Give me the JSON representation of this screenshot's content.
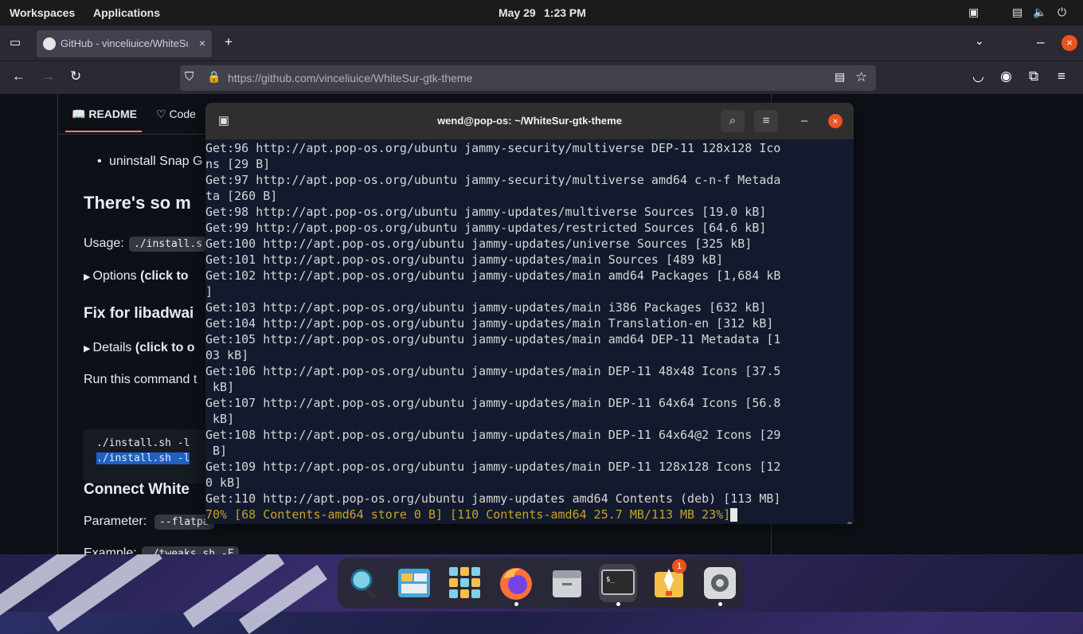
{
  "top_bar": {
    "workspaces": "Workspaces",
    "applications": "Applications",
    "date": "May 29",
    "time": "1:23 PM"
  },
  "browser": {
    "tab_title": "GitHub - vinceliuice/WhiteSur-gtk-theme",
    "tab_close": "×",
    "new_tab": "+",
    "url_prefix": "https://github.com/",
    "url_path": "vinceliuice/WhiteSur-gtk-theme"
  },
  "readme": {
    "tab_readme": "README",
    "tab_code": "Code",
    "bullet_text": "uninstall Snap G",
    "heading_more": "There's so m",
    "usage_label": "Usage:",
    "usage_code": "./install.s",
    "options_label": "Options",
    "options_bold": "(click to",
    "heading_libadwaita": "Fix for libadwai",
    "details_label": "Details",
    "details_bold": "(click to o",
    "run_command": "Run this command t",
    "code_line1": "./install.sh -l",
    "code_line2": "./install.sh -l",
    "heading_connect": "Connect White",
    "parameter_label": "Parameter:",
    "parameter_code": "--flatpa",
    "example_label": "Example:",
    "example_code": "./tweaks.sh -F"
  },
  "terminal": {
    "title": "wend@pop-os: ~/WhiteSur-gtk-theme",
    "lines": [
      "Get:96 http://apt.pop-os.org/ubuntu jammy-security/multiverse DEP-11 128x128 Ico",
      "ns [29 B]",
      "Get:97 http://apt.pop-os.org/ubuntu jammy-security/multiverse amd64 c-n-f Metada",
      "ta [260 B]",
      "Get:98 http://apt.pop-os.org/ubuntu jammy-updates/multiverse Sources [19.0 kB]",
      "Get:99 http://apt.pop-os.org/ubuntu jammy-updates/restricted Sources [64.6 kB]",
      "Get:100 http://apt.pop-os.org/ubuntu jammy-updates/universe Sources [325 kB]",
      "Get:101 http://apt.pop-os.org/ubuntu jammy-updates/main Sources [489 kB]",
      "Get:102 http://apt.pop-os.org/ubuntu jammy-updates/main amd64 Packages [1,684 kB",
      "]",
      "Get:103 http://apt.pop-os.org/ubuntu jammy-updates/main i386 Packages [632 kB]",
      "Get:104 http://apt.pop-os.org/ubuntu jammy-updates/main Translation-en [312 kB]",
      "Get:105 http://apt.pop-os.org/ubuntu jammy-updates/main amd64 DEP-11 Metadata [1",
      "03 kB]",
      "Get:106 http://apt.pop-os.org/ubuntu jammy-updates/main DEP-11 48x48 Icons [37.5",
      " kB]",
      "Get:107 http://apt.pop-os.org/ubuntu jammy-updates/main DEP-11 64x64 Icons [56.8",
      " kB]",
      "Get:108 http://apt.pop-os.org/ubuntu jammy-updates/main DEP-11 64x64@2 Icons [29",
      " B]",
      "Get:109 http://apt.pop-os.org/ubuntu jammy-updates/main DEP-11 128x128 Icons [12",
      "0 kB]",
      "Get:110 http://apt.pop-os.org/ubuntu jammy-updates amd64 Contents (deb) [113 MB]"
    ],
    "progress_line": "70% [68 Contents-amd64 store 0 B] [110 Contents-amd64 25.7 MB/113 MB 23%]"
  },
  "dock": {
    "items": [
      "search-app",
      "files-manager",
      "app-grid",
      "firefox",
      "file-cabinet",
      "terminal",
      "pop-shop",
      "settings"
    ],
    "pop_shop_badge": "1"
  },
  "colors": {
    "terminal_bg": "#131a2d",
    "progress_text": "#c7a328",
    "close_button": "#e95420",
    "github_bg": "#0d1117"
  }
}
